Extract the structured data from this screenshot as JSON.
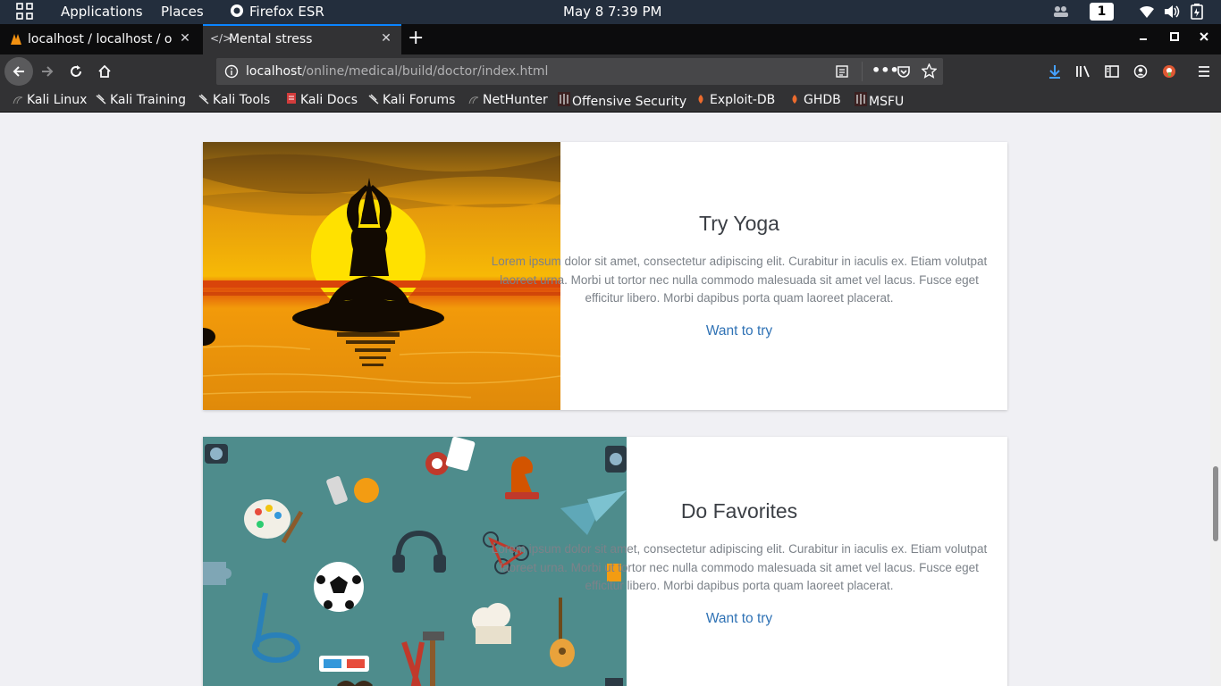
{
  "system": {
    "applications_label": "Applications",
    "places_label": "Places",
    "firefox_label": "Firefox ESR",
    "date": "May 8",
    "time": "7:39 PM",
    "workspace": "1"
  },
  "tabs": [
    {
      "label": "localhost / localhost / onli"
    },
    {
      "label": "Mental stress"
    }
  ],
  "urlbar": {
    "host": "localhost",
    "path": "/online/medical/build/doctor/index.html"
  },
  "bookmarks": [
    {
      "label": "Kali Linux",
      "icon": "kali-icon"
    },
    {
      "label": "Kali Training",
      "icon": "kali-icon"
    },
    {
      "label": "Kali Tools",
      "icon": "kali-icon"
    },
    {
      "label": "Kali Docs",
      "icon": "kali-docs-icon"
    },
    {
      "label": "Kali Forums",
      "icon": "kali-icon"
    },
    {
      "label": "NetHunter",
      "icon": "nethunter-icon"
    },
    {
      "label": "Offensive Security",
      "icon": "offsec-icon"
    },
    {
      "label": "Exploit-DB",
      "icon": "exploitdb-icon"
    },
    {
      "label": "GHDB",
      "icon": "exploitdb-icon"
    },
    {
      "label": "MSFU",
      "icon": "offsec-icon"
    }
  ],
  "cards": [
    {
      "title": "Try Yoga",
      "text": "Lorem ipsum dolor sit amet, consectetur adipiscing elit. Curabitur in iaculis ex. Etiam volutpat laoreet urna. Morbi ut tortor nec nulla commodo malesuada sit amet vel lacus. Fusce eget efficitur libero. Morbi dapibus porta quam laoreet placerat.",
      "link": "Want to try"
    },
    {
      "title": "Do Favorites",
      "text": "Lorem ipsum dolor sit amet, consectetur adipiscing elit. Curabitur in iaculis ex. Etiam volutpat laoreet urna. Morbi ut tortor nec nulla commodo malesuada sit amet vel lacus. Fusce eget efficitur libero. Morbi dapibus porta quam laoreet placerat.",
      "link": "Want to try"
    }
  ],
  "colors": {
    "link": "#2f72b5",
    "accent_tab": "#0a84ff",
    "system_bar": "#232e3d"
  }
}
